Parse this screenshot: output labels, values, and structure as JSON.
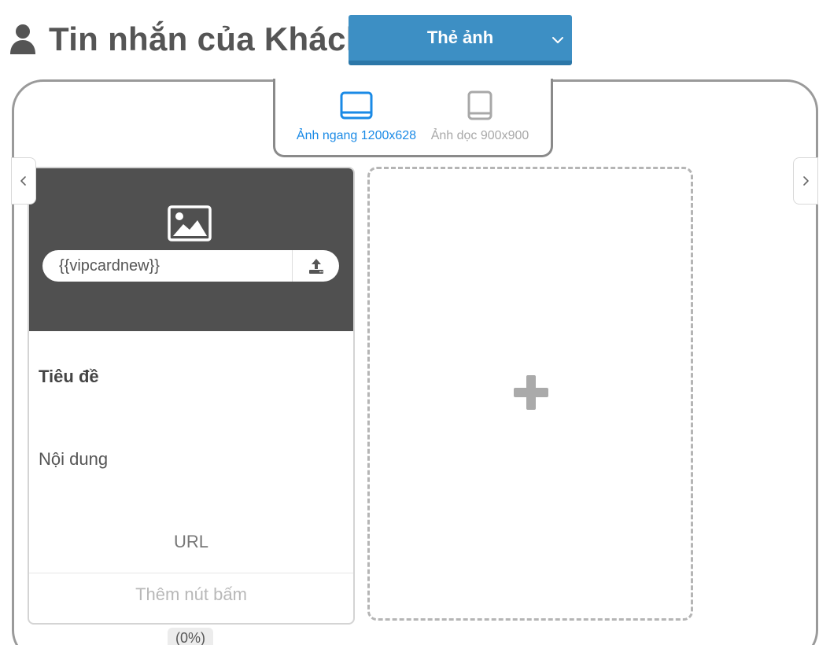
{
  "header": {
    "title": "Tin nhắn của Khách",
    "icon": "user-icon"
  },
  "type_select": {
    "selected": "Thẻ ảnh",
    "icon": "chevron-down-icon"
  },
  "orientation_tabs": [
    {
      "label": "Ảnh ngang 1200x628",
      "icon": "landscape-icon",
      "active": true
    },
    {
      "label": "Ảnh dọc 900x900",
      "icon": "portrait-icon",
      "active": false
    }
  ],
  "card": {
    "image_url_value": "{{vipcardnew}}",
    "title": "Tiêu đề",
    "content": "Nội dung",
    "url_label": "URL",
    "add_button_label": "Thêm nút bấm",
    "progress": "(0%)"
  },
  "colors": {
    "accent": "#3d8fc4",
    "active_tab": "#1a8ae6",
    "image_area": "#505050",
    "frame_border": "#9a9a9a"
  }
}
